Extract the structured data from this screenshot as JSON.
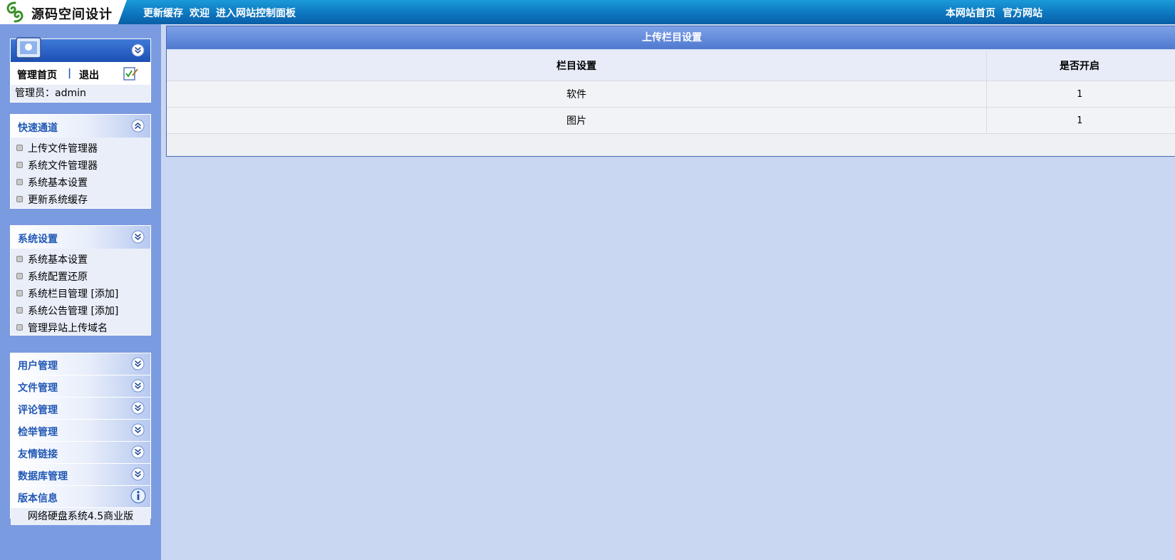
{
  "header": {
    "logo_text": "源码空间设计",
    "links_left": [
      "更新缓存",
      "欢迎",
      "进入网站控制面板"
    ],
    "links_right": [
      "本网站首页",
      "官方网站"
    ]
  },
  "admin_panel": {
    "home_label": "管理首页",
    "separator": "|",
    "logout_label": "退出",
    "admin_label": "管理员：admin"
  },
  "quick_panel": {
    "title": "快速通道",
    "items": [
      "上传文件管理器",
      "系统文件管理器",
      "系统基本设置",
      "更新系统缓存"
    ]
  },
  "system_panel": {
    "title": "系统设置",
    "items": [
      "系统基本设置",
      "系统配置还原",
      "系统栏目管理 [添加]",
      "系统公告管理 [添加]",
      "管理异站上传域名"
    ]
  },
  "collapsed_panels": [
    "用户管理",
    "文件管理",
    "评论管理",
    "检举管理",
    "友情链接",
    "数据库管理"
  ],
  "version_panel": {
    "title": "版本信息",
    "text": "网络硬盘系统4.5商业版"
  },
  "main": {
    "title": "上传栏目设置",
    "columns": [
      "栏目设置",
      "是否开启"
    ],
    "rows": [
      {
        "name": "软件",
        "enabled": "1"
      },
      {
        "name": "图片",
        "enabled": "1"
      }
    ]
  }
}
